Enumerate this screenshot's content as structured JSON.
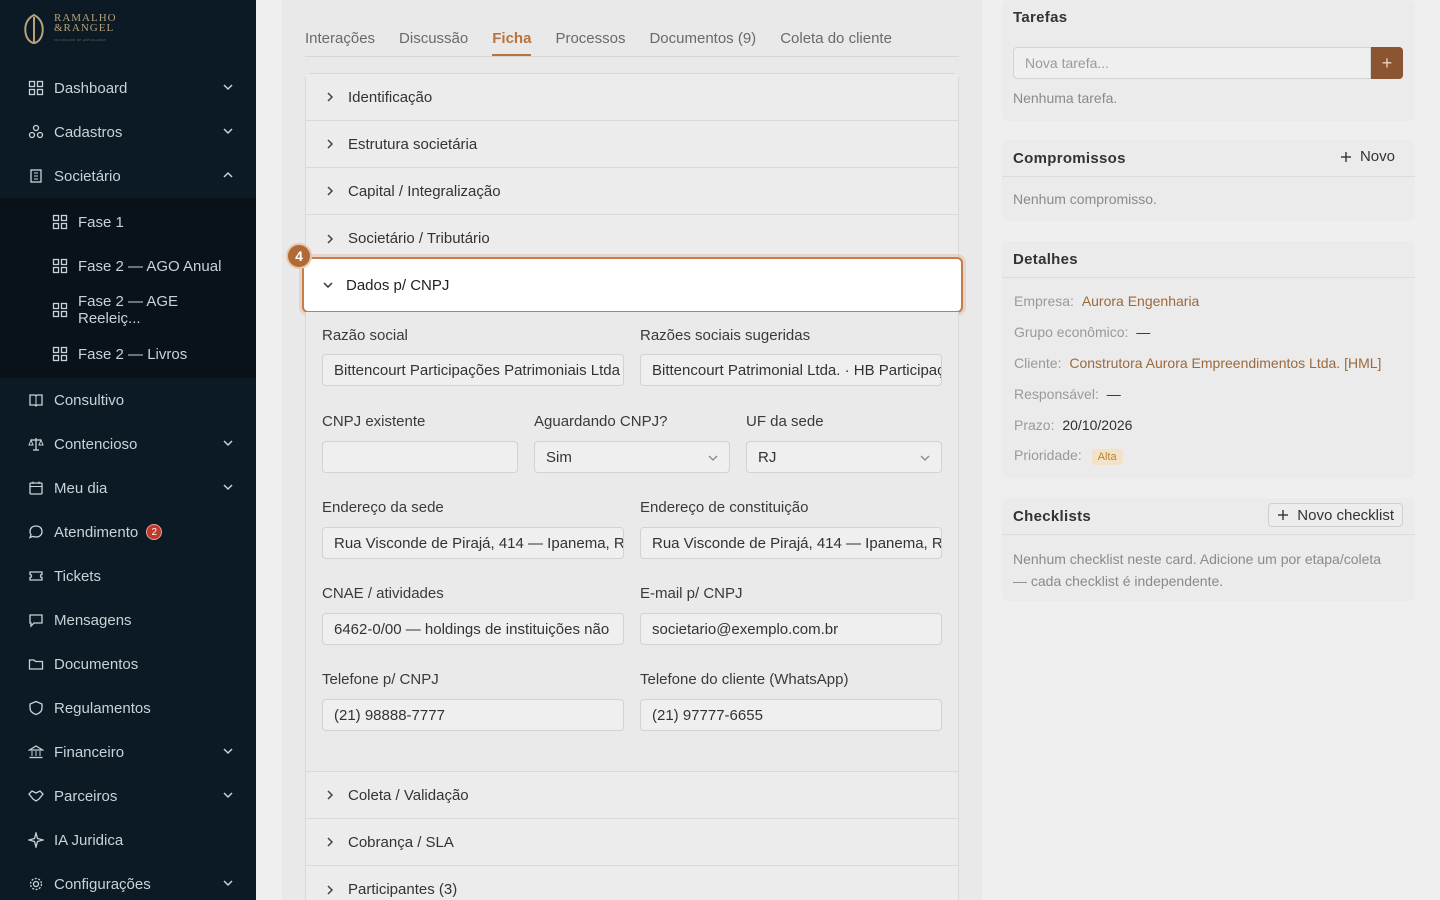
{
  "brand": {
    "line1": "RAMALHO",
    "line2": "&RANGEL",
    "line3": "SOCIEDADE DE ADVOGADOS"
  },
  "sidebar": {
    "items": [
      {
        "label": "Dashboard",
        "icon": "grid-icon",
        "chevron": "down"
      },
      {
        "label": "Cadastros",
        "icon": "nodes-icon",
        "chevron": "down"
      },
      {
        "label": "Societário",
        "icon": "building-icon",
        "chevron": "up"
      },
      {
        "label": "Consultivo",
        "icon": "book-icon"
      },
      {
        "label": "Contencioso",
        "icon": "scale-icon",
        "chevron": "down"
      },
      {
        "label": "Meu dia",
        "icon": "calendar-icon",
        "chevron": "down"
      },
      {
        "label": "Atendimento",
        "icon": "chat-bubble-icon",
        "badge": "2"
      },
      {
        "label": "Tickets",
        "icon": "ticket-icon"
      },
      {
        "label": "Mensagens",
        "icon": "message-icon"
      },
      {
        "label": "Documentos",
        "icon": "folder-icon"
      },
      {
        "label": "Regulamentos",
        "icon": "shield-icon"
      },
      {
        "label": "Financeiro",
        "icon": "bank-icon",
        "chevron": "down"
      },
      {
        "label": "Parceiros",
        "icon": "handshake-icon",
        "chevron": "down"
      },
      {
        "label": "IA Juridica",
        "icon": "sparkle-icon"
      },
      {
        "label": "Configurações",
        "icon": "gear-icon",
        "chevron": "down"
      }
    ],
    "subitems": [
      {
        "label": "Fase 1"
      },
      {
        "label": "Fase 2 — AGO Anual"
      },
      {
        "label": "Fase 2 — AGE Reeleiç..."
      },
      {
        "label": "Fase 2 — Livros"
      }
    ]
  },
  "tabs": [
    {
      "label": "Interações"
    },
    {
      "label": "Discussão"
    },
    {
      "label": "Ficha",
      "active": true
    },
    {
      "label": "Processos"
    },
    {
      "label": "Documentos (9)"
    },
    {
      "label": "Coleta do cliente"
    }
  ],
  "accordion_top": [
    "Identificação",
    "Estrutura societária",
    "Capital / Integralização",
    "Societário / Tributário"
  ],
  "accordion_open": {
    "label": "Dados p/ CNPJ",
    "step": "4"
  },
  "accordion_bottom": [
    "Coleta / Validação",
    "Cobrança / SLA",
    "Participantes (3)"
  ],
  "form": {
    "razao_social": {
      "label": "Razão social",
      "value": "Bittencourt Participações Patrimoniais Ltda"
    },
    "razoes_sugeridas": {
      "label": "Razões sociais sugeridas",
      "value": "Bittencourt Patrimonial Ltda. · HB Participaç"
    },
    "cnpj_existente": {
      "label": "CNPJ existente",
      "value": ""
    },
    "aguardando_cnpj": {
      "label": "Aguardando CNPJ?",
      "value": "Sim"
    },
    "uf_sede": {
      "label": "UF da sede",
      "value": "RJ"
    },
    "endereco_sede": {
      "label": "Endereço da sede",
      "value": "Rua Visconde de Pirajá, 414 — Ipanema, R"
    },
    "endereco_constituicao": {
      "label": "Endereço de constituição",
      "value": "Rua Visconde de Pirajá, 414 — Ipanema, R"
    },
    "cnae": {
      "label": "CNAE / atividades",
      "value": "6462-0/00 — holdings de instituições não"
    },
    "email_cnpj": {
      "label": "E-mail p/ CNPJ",
      "value": "societario@exemplo.com.br"
    },
    "telefone_cnpj": {
      "label": "Telefone p/ CNPJ",
      "value": "(21) 98888-7777"
    },
    "telefone_cliente": {
      "label": "Telefone do cliente (WhatsApp)",
      "value": "(21) 97777-6655"
    }
  },
  "tarefas": {
    "title": "Tarefas",
    "placeholder": "Nova tarefa...",
    "add": "+",
    "empty": "Nenhuma tarefa."
  },
  "compromissos": {
    "title": "Compromissos",
    "new_label": "Novo",
    "empty": "Nenhum compromisso."
  },
  "detalhes": {
    "title": "Detalhes",
    "rows": [
      {
        "k": "Empresa",
        "v": "Aurora Engenharia"
      },
      {
        "k": "Grupo econômico",
        "v": "—"
      },
      {
        "k": "Cliente",
        "v": "Construtora Aurora Empreendimentos Ltda. [HML]"
      },
      {
        "k": "Responsável",
        "v": "—"
      },
      {
        "k": "Prazo",
        "v": "20/10/2026"
      },
      {
        "k": "Prioridade",
        "v": "Alta"
      }
    ]
  },
  "checklists": {
    "title": "Checklists",
    "new_label": "Novo checklist",
    "empty_line1": "Nenhum checklist neste card. Adicione um por etapa/coleta",
    "empty_line2": "— cada checklist é independente."
  },
  "colors": {
    "accent": "#b8743c",
    "sidebar_bg": "#0b1a24",
    "badge": "#c0392b"
  }
}
